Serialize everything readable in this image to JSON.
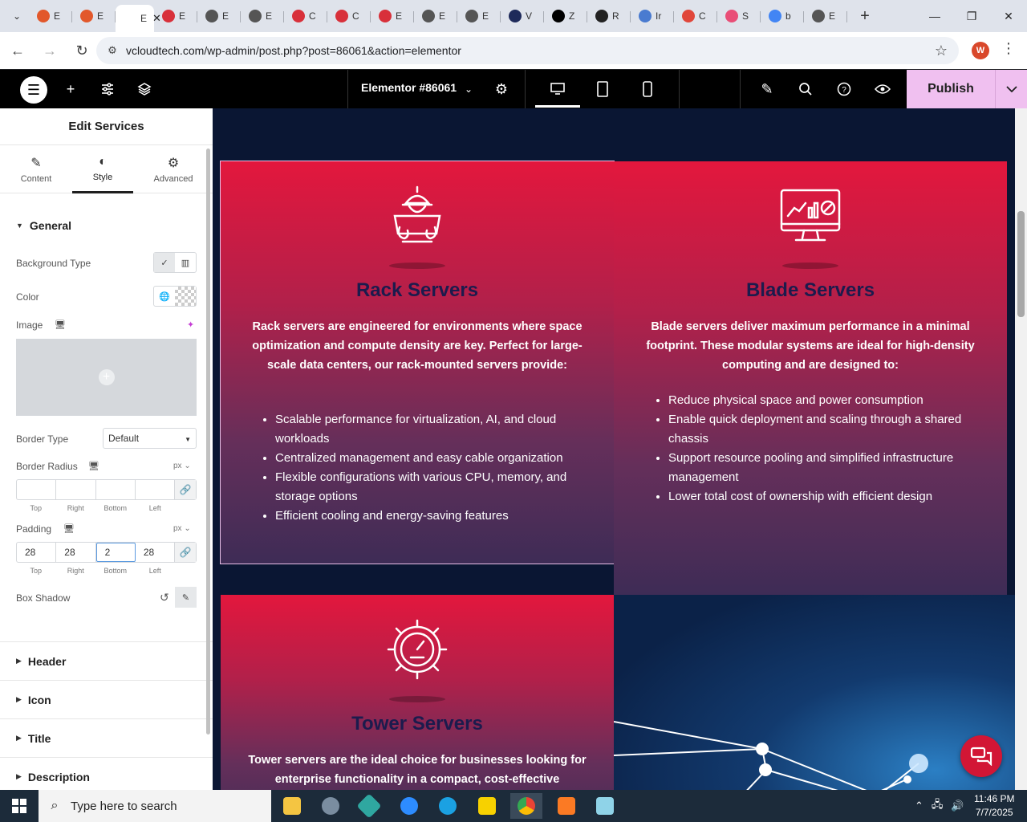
{
  "browser": {
    "tabs": [
      {
        "label": "E",
        "color": "#e2582b"
      },
      {
        "label": "E",
        "color": "#e2582b"
      },
      {
        "label": "E",
        "color": "#ffffff",
        "active": true
      },
      {
        "label": "E",
        "color": "#d8303a"
      },
      {
        "label": "E",
        "color": "#555555"
      },
      {
        "label": "E",
        "color": "#555555"
      },
      {
        "label": "C",
        "color": "#d8303a"
      },
      {
        "label": "C",
        "color": "#d8303a"
      },
      {
        "label": "E",
        "color": "#d8303a"
      },
      {
        "label": "E",
        "color": "#555555"
      },
      {
        "label": "E",
        "color": "#555555"
      },
      {
        "label": "V",
        "color": "#1e2a5a"
      },
      {
        "label": "Z",
        "color": "#000000"
      },
      {
        "label": "R",
        "color": "#222222"
      },
      {
        "label": "Ir",
        "color": "#4a7bd0"
      },
      {
        "label": "C",
        "color": "#e0463a"
      },
      {
        "label": "S",
        "color": "#e94e77"
      },
      {
        "label": "b",
        "color": "#4285f4"
      },
      {
        "label": "E",
        "color": "#555555"
      }
    ],
    "url": "vcloudtech.com/wp-admin/post.php?post=86061&action=elementor",
    "profile_initial": "W"
  },
  "elementor": {
    "document_title": "Elementor #86061",
    "publish_label": "Publish"
  },
  "panel": {
    "title": "Edit Services",
    "tabs": [
      {
        "label": "Content",
        "icon": "pencil-icon"
      },
      {
        "label": "Style",
        "icon": "contrast-icon"
      },
      {
        "label": "Advanced",
        "icon": "gear-icon"
      }
    ],
    "general_label": "General",
    "background_type_label": "Background Type",
    "color_label": "Color",
    "image_label": "Image",
    "border_type_label": "Border Type",
    "border_type_value": "Default",
    "border_radius_label": "Border Radius",
    "unit_px": "px",
    "dim_labels": [
      "Top",
      "Right",
      "Bottom",
      "Left"
    ],
    "border_radius_values": [
      "",
      "",
      "",
      ""
    ],
    "padding_label": "Padding",
    "padding_values": [
      "28",
      "28",
      "2",
      "28"
    ],
    "box_shadow_label": "Box Shadow",
    "sections": [
      "Header",
      "Icon",
      "Title",
      "Description"
    ]
  },
  "cards": [
    {
      "title": "Rack Servers",
      "description": "Rack servers are engineered for environments where space optimization and compute density are key. Perfect for large-scale data centers, our rack-mounted servers provide:",
      "bullets": [
        "Scalable performance for virtualization, AI, and cloud workloads",
        "Centralized management and easy cable organization",
        "Flexible configurations with various CPU, memory, and storage options",
        "Efficient cooling and energy-saving features"
      ]
    },
    {
      "title": "Blade Servers",
      "description": "Blade servers deliver maximum performance in a minimal footprint. These modular systems are ideal for high-density computing and are designed to:",
      "bullets": [
        "Reduce physical space and power consumption",
        "Enable quick deployment and scaling through a shared chassis",
        "Support resource pooling and simplified infrastructure management",
        "Lower total cost of ownership with efficient design"
      ]
    },
    {
      "title": "Tower Servers",
      "description": "Tower servers are the ideal choice for businesses looking for enterprise functionality in a compact, cost-effective",
      "bullets": []
    }
  ],
  "taskbar": {
    "search_placeholder": "Type here to search",
    "time": "11:46 PM",
    "date": "7/7/2025"
  }
}
